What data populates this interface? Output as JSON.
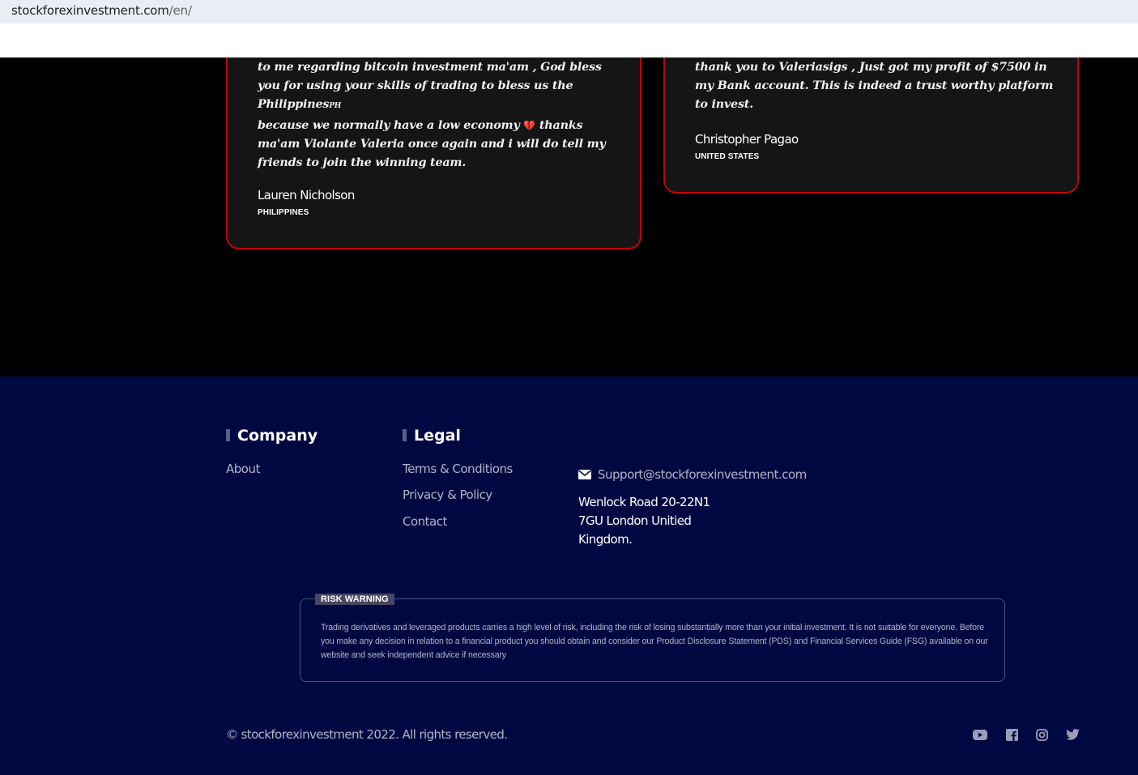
{
  "browser": {
    "url_domain": "stockforexinvestment.com",
    "url_path": "/en/"
  },
  "testimonials": [
    {
      "quote_part1": "to me regarding bitcoin investment ma'am , God bless you for using your skills of trading to bless us the Philippines",
      "quote_flag": "PH",
      "quote_part2": " because we normally have a low economy ",
      "quote_heart": "💔",
      "quote_part3": " thanks ma'am Violante Valeria once again and i will do tell my friends to join the winning team.",
      "author": "Lauren Nicholson",
      "country": "PHILIPPINES"
    },
    {
      "quote": "thank you to Valeriasigs , Just got my profit of $7500 in my Bank account. This is indeed a trust worthy platform to invest.",
      "author": "Christopher Pagao",
      "country": "UNITED STATES"
    }
  ],
  "footer": {
    "company": {
      "title": "Company",
      "links": [
        "About"
      ]
    },
    "legal": {
      "title": "Legal",
      "links": [
        "Terms & Conditions",
        "Privacy & Policy",
        "Contact"
      ]
    },
    "contact": {
      "email": "Support@stockforexinvestment.com",
      "address_lines": [
        "Wenlock Road 20-22N1",
        "7GU London Unitied",
        "Kingdom."
      ]
    },
    "risk": {
      "label": "RISK WARNING",
      "text": "Trading derivatives and leveraged products carries a high level of risk, including the risk of losing substantially more than your initial investment. It is not suitable for everyone. Before you make any decision in relation to a financial product you should obtain and consider our Product Disclosure Statement (PDS) and Financial Services Guide (FSG) available on our website and seek independent advice if necessary"
    },
    "copyright": "© stockforexinvestment 2022. All rights reserved.",
    "social_icons": [
      "youtube-icon",
      "facebook-icon",
      "instagram-icon",
      "twitter-icon"
    ]
  },
  "colors": {
    "footer_bg": "#000842",
    "card_border": "#c4000a",
    "card_bg": "#151515",
    "muted_text": "#b1b3c6"
  }
}
